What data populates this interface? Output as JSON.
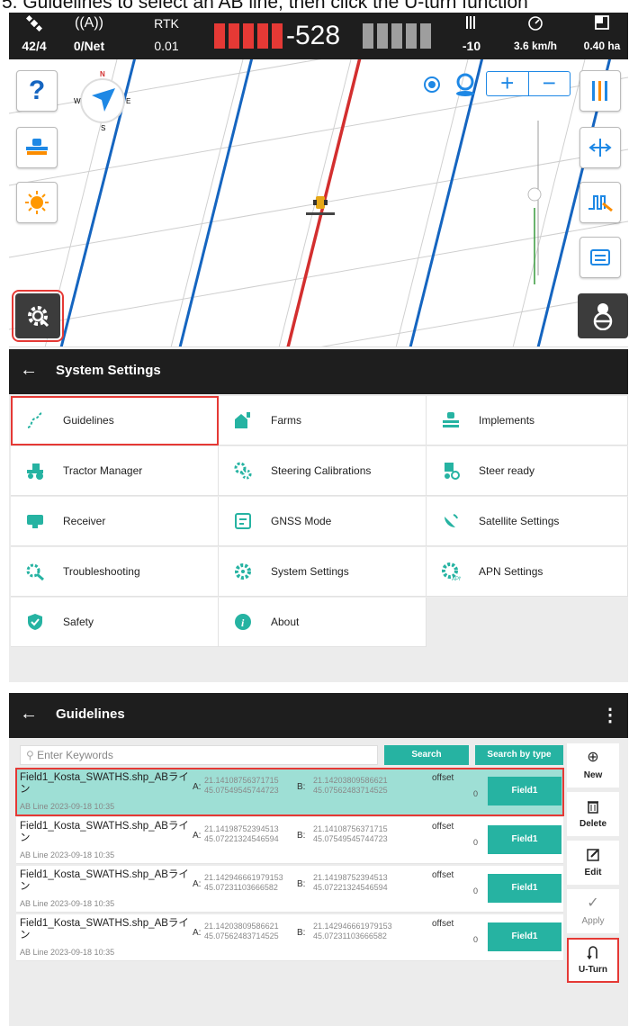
{
  "caption": "5. Guidelines to select an AB line, then click the U-turn function",
  "status_bar": {
    "satellites": {
      "icon": "satellite-icon",
      "value": "42/4"
    },
    "network": {
      "icon": "antenna-icon",
      "value": "0/Net"
    },
    "rtk": {
      "label": "RTK",
      "value": "0.01"
    },
    "lightbar_value": "-528",
    "lightbar_colors": {
      "active": "#e53935",
      "inactive": "#9e9e9e"
    },
    "signal": {
      "icon": "signal-bars-icon",
      "value": "-10"
    },
    "speed": {
      "icon": "speedometer-icon",
      "value": "3.6 km/h"
    },
    "area": {
      "icon": "area-icon",
      "value": "0.40 ha"
    }
  },
  "map": {
    "compass": {
      "n": "N",
      "s": "S",
      "w": "W",
      "e": "E"
    },
    "zoom_in": "+",
    "zoom_out": "−",
    "colors": {
      "guide_line": "#1565c0",
      "active_line": "#d32f2f",
      "grid": "#cfcfcf"
    }
  },
  "system_settings": {
    "title": "System Settings",
    "back": "←",
    "items": [
      {
        "label": "Guidelines",
        "icon": "guideline-curve-icon"
      },
      {
        "label": "Farms",
        "icon": "farm-icon"
      },
      {
        "label": "Implements",
        "icon": "implement-icon"
      },
      {
        "label": "Tractor Manager",
        "icon": "tractor-icon"
      },
      {
        "label": "Steering Calibrations",
        "icon": "calibration-gears-icon"
      },
      {
        "label": "Steer ready",
        "icon": "steer-ready-icon"
      },
      {
        "label": "Receiver",
        "icon": "receiver-icon"
      },
      {
        "label": "GNSS Mode",
        "icon": "gnss-mode-icon"
      },
      {
        "label": "Satellite Settings",
        "icon": "satellite-settings-icon"
      },
      {
        "label": "Troubleshooting",
        "icon": "troubleshooting-icon"
      },
      {
        "label": "System Settings",
        "icon": "gear-icon"
      },
      {
        "label": "APN Settings",
        "icon": "apn-icon"
      },
      {
        "label": "Safety",
        "icon": "shield-icon"
      },
      {
        "label": "About",
        "icon": "info-icon"
      }
    ]
  },
  "guidelines": {
    "title": "Guidelines",
    "back": "←",
    "more": "⋮",
    "search_placeholder": "Enter Keywords",
    "search_button": "Search",
    "search_by_type_button": "Search by type",
    "offset_label": "offset",
    "rows": [
      {
        "name": "Field1_Kosta_SWATHS.shp_ABライン",
        "date": "AB Line 2023-09-18 10:35",
        "a_label": "A:",
        "a_lon": "21.14108756371715",
        "a_lat": "45.07549545744723",
        "b_label": "B:",
        "b_lon": "21.14203809586621",
        "b_lat": "45.07562483714525",
        "offset": "0",
        "field": "Field1"
      },
      {
        "name": "Field1_Kosta_SWATHS.shp_ABライン",
        "date": "AB Line 2023-09-18 10:35",
        "a_label": "A:",
        "a_lon": "21.14198752394513",
        "a_lat": "45.07221324546594",
        "b_label": "B:",
        "b_lon": "21.14108756371715",
        "b_lat": "45.07549545744723",
        "offset": "0",
        "field": "Field1"
      },
      {
        "name": "Field1_Kosta_SWATHS.shp_ABライン",
        "date": "AB Line 2023-09-18 10:35",
        "a_label": "A:",
        "a_lon": "21.142946661979153",
        "a_lat": "45.07231103666582",
        "b_label": "B:",
        "b_lon": "21.14198752394513",
        "b_lat": "45.07221324546594",
        "offset": "0",
        "field": "Field1"
      },
      {
        "name": "Field1_Kosta_SWATHS.shp_ABライン",
        "date": "AB Line 2023-09-18 10:35",
        "a_label": "A:",
        "a_lon": "21.14203809586621",
        "a_lat": "45.07562483714525",
        "b_label": "B:",
        "b_lon": "21.142946661979153",
        "b_lat": "45.07231103666582",
        "offset": "0",
        "field": "Field1"
      }
    ],
    "side_buttons": [
      {
        "label": "New",
        "icon": "plus-circle-icon",
        "glyph": "⊕"
      },
      {
        "label": "Delete",
        "icon": "trash-icon",
        "glyph": "🗑"
      },
      {
        "label": "Edit",
        "icon": "edit-icon",
        "glyph": "✎"
      },
      {
        "label": "Apply",
        "icon": "check-icon",
        "glyph": "✓"
      },
      {
        "label": "U-Turn",
        "icon": "u-turn-icon",
        "glyph": "∩"
      }
    ]
  },
  "accent_colors": {
    "teal": "#26b3a2",
    "highlight": "#e53935",
    "row_selected": "#9edfd5"
  }
}
